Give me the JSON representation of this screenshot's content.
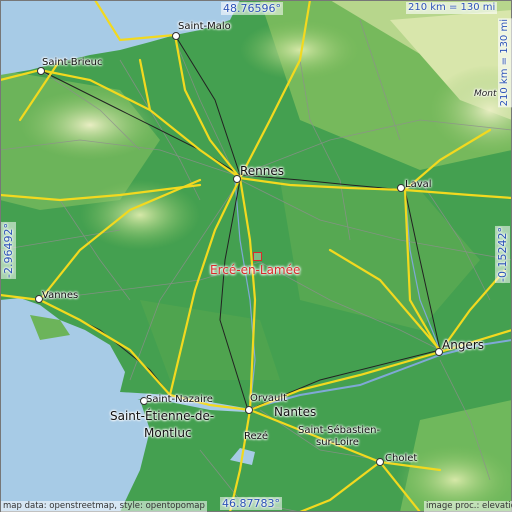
{
  "map": {
    "highlighted_place": "Ercé-en-Lamée",
    "coords": {
      "top": "48.76596°",
      "bottom": "46.87783°",
      "left": "-2.96492°",
      "right": "-0.15242°"
    },
    "scale": {
      "horizontal": "210 km = 130 mi",
      "vertical": "210 km = 130 mi"
    },
    "credits": {
      "left": "map data: openstreetmap, style: opentopomap",
      "right": "image proc.: elevation.city"
    },
    "places": {
      "saint_malo": "Saint-Malo",
      "saint_brieuc": "Saint-Brieuc",
      "rennes": "Rennes",
      "laval": "Laval",
      "vannes": "Vannes",
      "angers": "Angers",
      "saint_nazaire": "Saint-Nazaire",
      "saint_etienne": "Saint-Étienne-de-",
      "montluc": "Montluc",
      "orvault": "Orvault",
      "nantes": "Nantes",
      "reze": "Rezé",
      "saint_sebastien": "Saint-Sébastien-",
      "sur_loire": "sur-Loire",
      "cholet": "Cholet",
      "mont": "Mont"
    },
    "colors": {
      "sea": "#a7cbe6",
      "lowland": "#3f9a4c",
      "upland": "#cfe3a0",
      "road": "#f2d91f",
      "highlight": "#d92b2b",
      "coord_text": "#2c53b7"
    }
  }
}
